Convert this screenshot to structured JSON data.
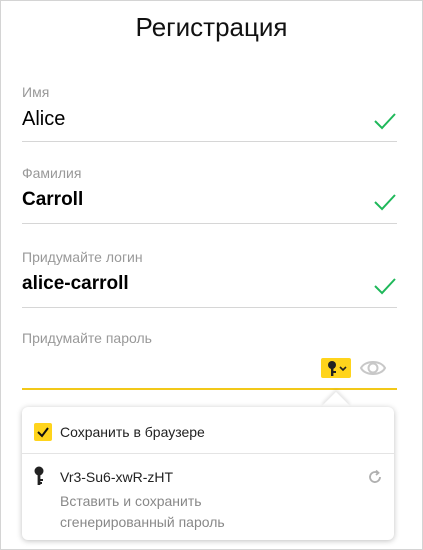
{
  "form": {
    "title": "Регистрация",
    "first_name": {
      "label": "Имя",
      "value": "Alice"
    },
    "last_name": {
      "label": "Фамилия",
      "value": "Carroll"
    },
    "login": {
      "label": "Придумайте логин",
      "value": "alice-carroll"
    },
    "password": {
      "label": "Придумайте пароль",
      "value": ""
    }
  },
  "popup": {
    "save_label": "Сохранить в браузере",
    "save_checked": true,
    "generated_password": "Vr3-Su6-xwR-zHT",
    "hint": "Вставить и сохранить сгенерированный пароль"
  },
  "icons": {
    "valid": "check-icon",
    "password_generator": "key-icon",
    "show_password": "eye-icon",
    "regenerate": "refresh-icon"
  },
  "colors": {
    "accent": "#ffd41c",
    "valid": "#1fb85a",
    "focus_underline": "#f2c819",
    "label": "#999999"
  }
}
